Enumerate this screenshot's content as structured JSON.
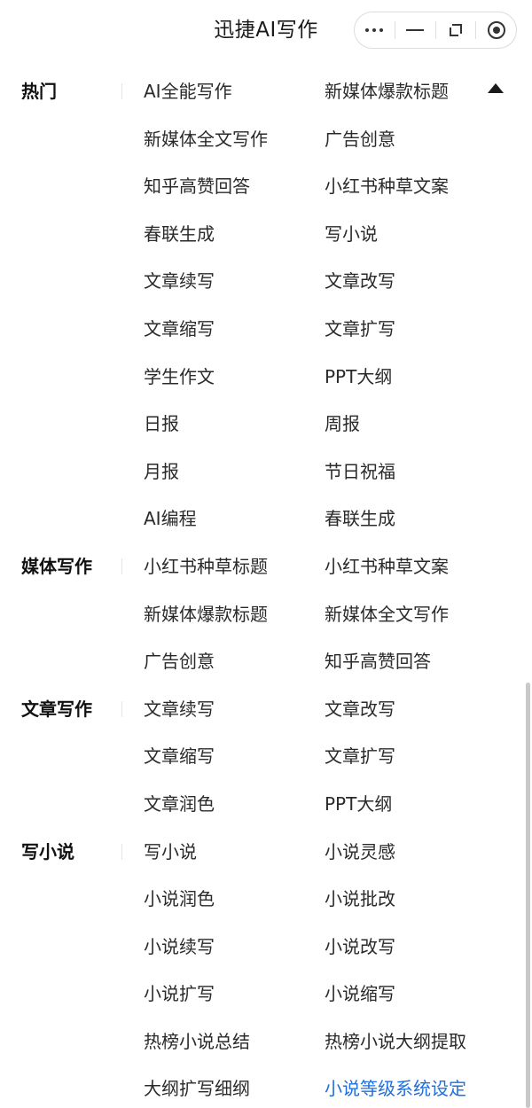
{
  "header": {
    "title": "迅捷AI写作",
    "capsule_icons": [
      "more-icon",
      "minimize-icon",
      "restore-icon",
      "close-record-icon"
    ]
  },
  "categories": [
    {
      "label": "热门",
      "items": [
        [
          "AI全能写作",
          "新媒体爆款标题"
        ],
        [
          "新媒体全文写作",
          "广告创意"
        ],
        [
          "知乎高赞回答",
          "小红书种草文案"
        ],
        [
          "春联生成",
          "写小说"
        ],
        [
          "文章续写",
          "文章改写"
        ],
        [
          "文章缩写",
          "文章扩写"
        ],
        [
          "学生作文",
          "PPT大纲"
        ],
        [
          "日报",
          "周报"
        ],
        [
          "月报",
          "节日祝福"
        ],
        [
          "AI编程",
          "春联生成"
        ]
      ]
    },
    {
      "label": "媒体写作",
      "items": [
        [
          "小红书种草标题",
          "小红书种草文案"
        ],
        [
          "新媒体爆款标题",
          "新媒体全文写作"
        ],
        [
          "广告创意",
          "知乎高赞回答"
        ]
      ]
    },
    {
      "label": "文章写作",
      "items": [
        [
          "文章续写",
          "文章改写"
        ],
        [
          "文章缩写",
          "文章扩写"
        ],
        [
          "文章润色",
          "PPT大纲"
        ]
      ]
    },
    {
      "label": "写小说",
      "items": [
        [
          "写小说",
          "小说灵感"
        ],
        [
          "小说润色",
          "小说批改"
        ],
        [
          "小说续写",
          "小说改写"
        ],
        [
          "小说扩写",
          "小说缩写"
        ],
        [
          "热榜小说总结",
          "热榜小说大纲提取"
        ],
        [
          "大纲扩写细纲",
          "小说等级系统设定"
        ]
      ]
    }
  ],
  "colors": {
    "accent_link": "#1f6fe0",
    "text": "#2a2a2a"
  }
}
